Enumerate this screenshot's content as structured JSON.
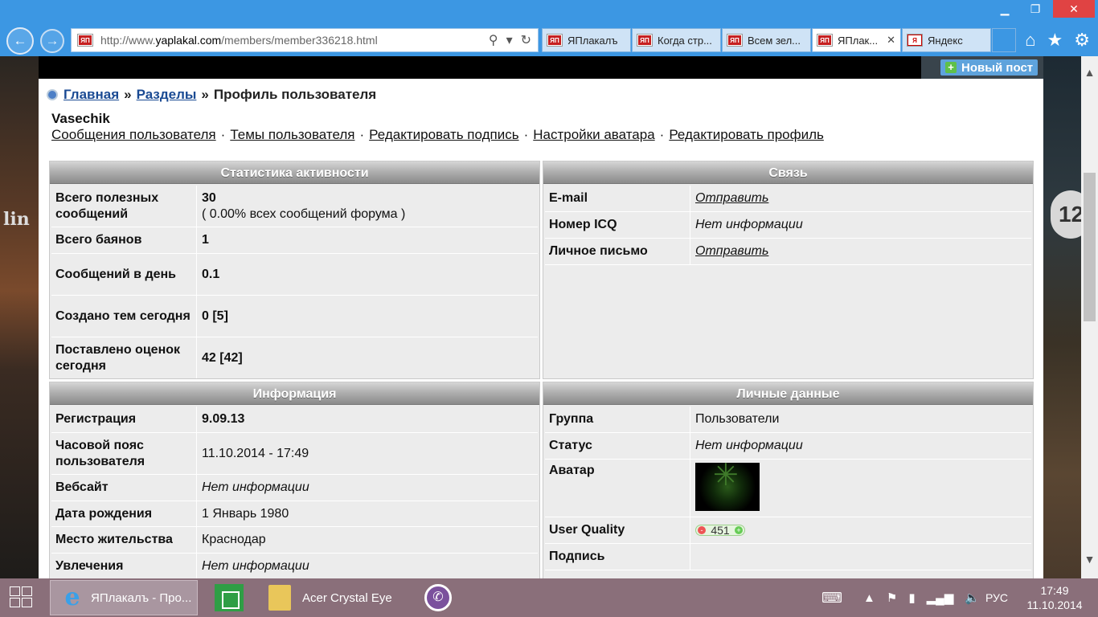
{
  "browser": {
    "url_prefix": "http://www.",
    "url_domain": "yaplakal.com",
    "url_path": "/members/member336218.html",
    "favicon_text": "ЯП",
    "tabs": [
      {
        "label": "ЯПлакалъ",
        "active": false
      },
      {
        "label": "Когда стр...",
        "active": false
      },
      {
        "label": "Всем зел...",
        "active": false
      },
      {
        "label": "ЯПлак...",
        "active": true
      },
      {
        "label": "Яндекс",
        "active": false
      }
    ],
    "yandex_favicon": "Я"
  },
  "banner": {
    "new_post": "Новый пост",
    "age_rating": "12",
    "side_text": "lin"
  },
  "breadcrumb": {
    "home": "Главная",
    "sections": "Разделы",
    "current": "Профиль пользователя",
    "separator": "»"
  },
  "user": {
    "name": "Vasechik",
    "links": [
      "Сообщения пользователя",
      "Темы пользователя",
      "Редактировать подпись",
      "Настройки аватара",
      "Редактировать профиль"
    ],
    "link_separator": "·"
  },
  "activity": {
    "title": "Статистика активности",
    "rows": [
      {
        "key": "Всего полезных сообщений",
        "value": "30",
        "value2": "( 0.00% всех сообщений форума )"
      },
      {
        "key": "Всего баянов",
        "value": "1"
      },
      {
        "key": "Сообщений в день",
        "value": "0.1"
      },
      {
        "key": "Создано тем сегодня",
        "value": "0 [5]"
      },
      {
        "key": "Поставлено оценок сегодня",
        "value": "42 [42]"
      }
    ]
  },
  "contact": {
    "title": "Связь",
    "rows": [
      {
        "key": "E-mail",
        "value": "Отправить"
      },
      {
        "key": "Номер ICQ",
        "value": "Нет информации"
      },
      {
        "key": "Личное письмо",
        "value": "Отправить"
      }
    ]
  },
  "info": {
    "title": "Информация",
    "rows": [
      {
        "key": "Регистрация",
        "value": "9.09.13"
      },
      {
        "key": "Часовой пояс пользователя",
        "value": "11.10.2014 - 17:49"
      },
      {
        "key": "Вебсайт",
        "value": "Нет информации"
      },
      {
        "key": "Дата рождения",
        "value": "1 Январь 1980"
      },
      {
        "key": "Место жительства",
        "value": "Краснодар"
      },
      {
        "key": "Увлечения",
        "value": "Нет информации"
      }
    ]
  },
  "personal": {
    "title": "Личные данные",
    "rows": [
      {
        "key": "Группа",
        "value": "Пользователи"
      },
      {
        "key": "Статус",
        "value": "Нет информации"
      },
      {
        "key": "Аватар",
        "value": ""
      },
      {
        "key": "User Quality",
        "value": "451",
        "minus": "-",
        "plus": "+"
      },
      {
        "key": "Подпись",
        "value": ""
      }
    ]
  },
  "taskbar": {
    "ie_label": "ЯПлакалъ - Про...",
    "acer_label": "Acer Crystal Eye",
    "lang": "РУС",
    "time": "17:49",
    "date": "11.10.2014"
  }
}
